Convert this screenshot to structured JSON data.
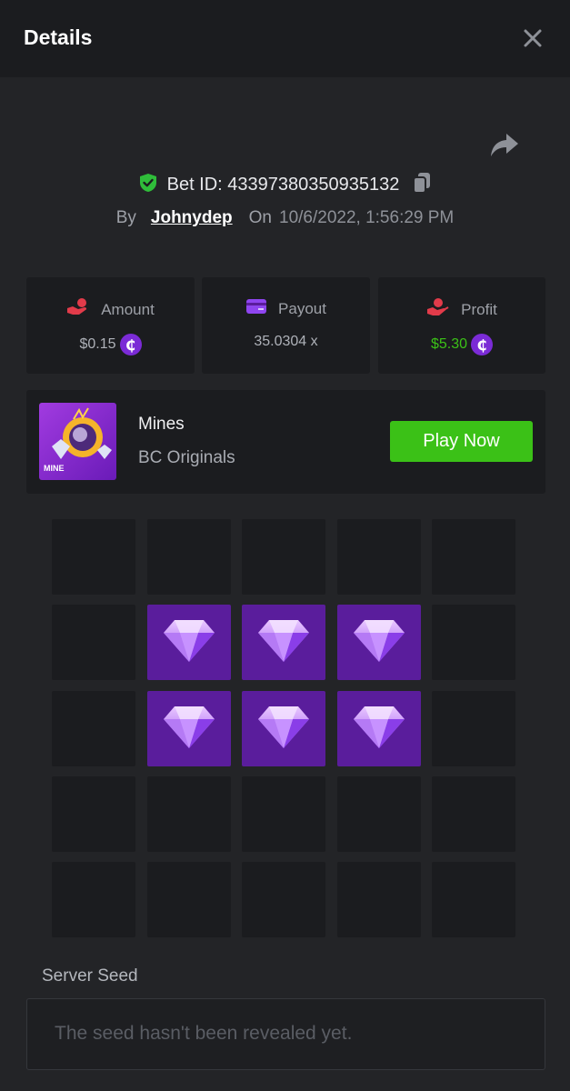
{
  "header": {
    "title": "Details",
    "close_icon": "close-icon"
  },
  "bet": {
    "id_label": "Bet ID: 43397380350935132",
    "by_label": "By",
    "user": "Johnydep",
    "on_label": "On",
    "date": "10/6/2022, 1:56:29 PM"
  },
  "stats": {
    "amount": {
      "label": "Amount",
      "value": "$0.15",
      "icon": "money-hand-icon"
    },
    "payout": {
      "label": "Payout",
      "value": "35.0304 x",
      "icon": "card-icon"
    },
    "profit": {
      "label": "Profit",
      "value": "$5.30",
      "icon": "profit-hand-icon"
    }
  },
  "coin_symbol": "₵",
  "game": {
    "name": "Mines",
    "provider": "BC Originals",
    "thumb_label": "MINE",
    "play_label": "Play Now"
  },
  "board": {
    "rows": 5,
    "cols": 5,
    "cells": [
      [
        "empty",
        "empty",
        "empty",
        "empty",
        "empty"
      ],
      [
        "empty",
        "gem",
        "gem",
        "gem",
        "empty"
      ],
      [
        "empty",
        "gem",
        "gem",
        "gem",
        "empty"
      ],
      [
        "empty",
        "empty",
        "empty",
        "empty",
        "empty"
      ],
      [
        "empty",
        "empty",
        "empty",
        "empty",
        "empty"
      ]
    ]
  },
  "seed": {
    "label": "Server Seed",
    "placeholder": "The seed hasn't been revealed yet."
  },
  "colors": {
    "accent_green": "#3bc117",
    "profit_green": "#3bc117",
    "gem_tile": "#5a1d9c",
    "coin": "#7b2bd6",
    "icon_red": "#e23b4a",
    "icon_purple": "#8f45f0"
  }
}
